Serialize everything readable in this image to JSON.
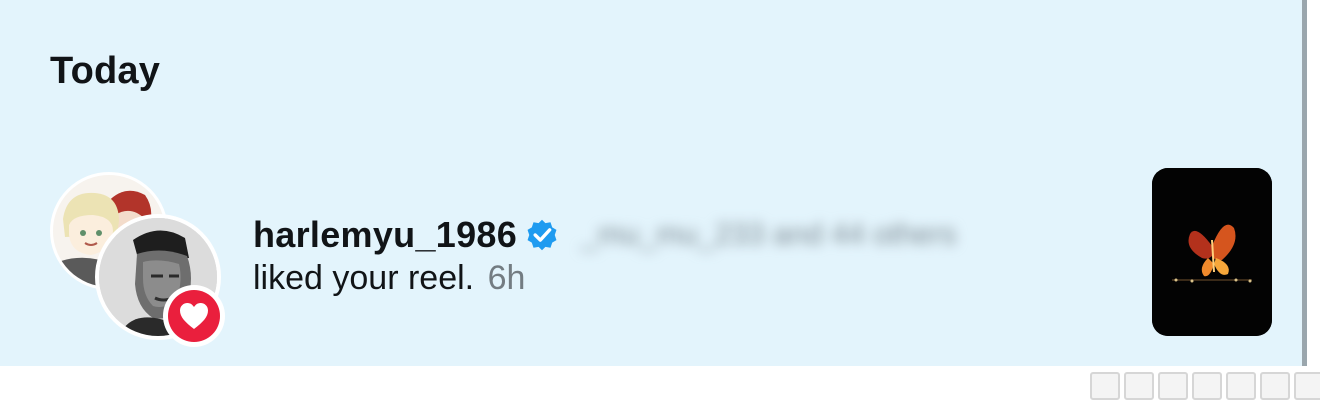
{
  "section": {
    "title": "Today"
  },
  "notification": {
    "username": "harlemyu_1986",
    "others_text": "_mu_mu_233 and 44 others",
    "action_text": "liked your reel.",
    "time": "6h",
    "badge_icon": "heart-icon",
    "verified_icon": "verified-badge-icon"
  },
  "colors": {
    "panel_bg": "#e3f4fc",
    "heart_badge": "#ea1f3d",
    "verified": "#1f9bf0",
    "text_primary": "#111417",
    "text_secondary": "#737c82"
  }
}
